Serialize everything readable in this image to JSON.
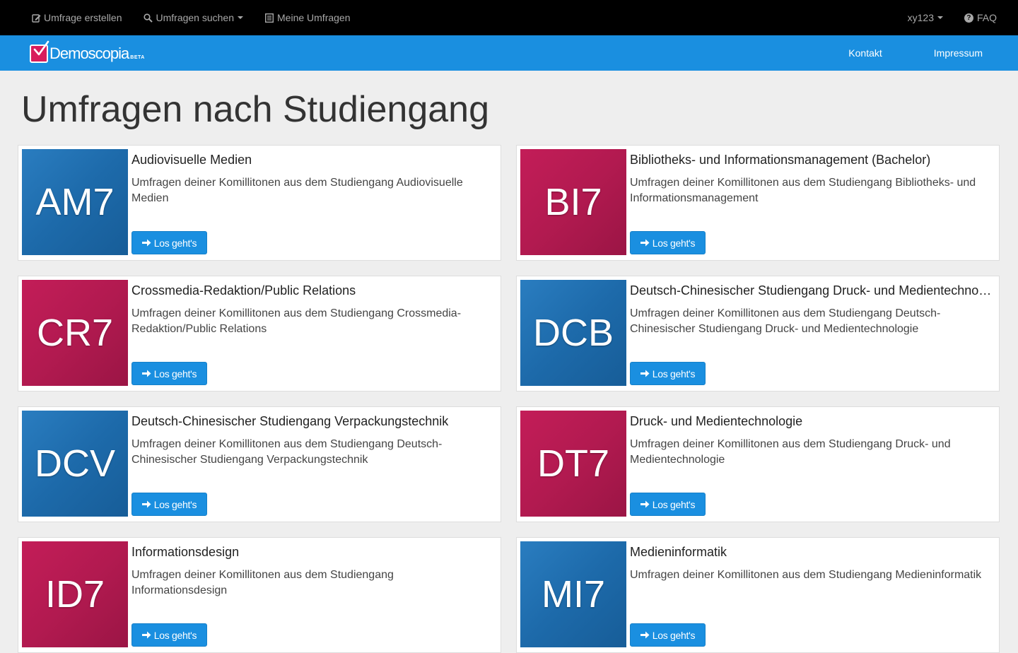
{
  "topnav": {
    "create": "Umfrage erstellen",
    "search": "Umfragen suchen",
    "mine": "Meine Umfragen",
    "user": "xy123",
    "faq": "FAQ"
  },
  "brand": {
    "name": "Demoscopia",
    "badge": "BETA",
    "links": [
      "Kontakt",
      "Impressum"
    ]
  },
  "page": {
    "title": "Umfragen nach Studiengang"
  },
  "button_label": "Los geht's",
  "courses": [
    {
      "code": "AM7",
      "color": "blue",
      "title": "Audiovisuelle Medien",
      "desc": "Umfragen deiner Komillitonen aus dem Studiengang Audiovisuelle Medien"
    },
    {
      "code": "BI7",
      "color": "pink",
      "title": "Bibliotheks- und Informationsmanagement (Bachelor)",
      "desc": "Umfragen deiner Komillitonen aus dem Studiengang Bibliotheks- und Informationsmanagement"
    },
    {
      "code": "CR7",
      "color": "pink",
      "title": "Crossmedia-Redaktion/Public Relations",
      "desc": "Umfragen deiner Komillitonen aus dem Studiengang Crossmedia-Redaktion/Public Relations"
    },
    {
      "code": "DCB",
      "color": "blue",
      "title": "Deutsch-Chinesischer Studiengang Druck- und Medientechnologie",
      "desc": "Umfragen deiner Komillitonen aus dem Studiengang Deutsch-Chinesischer Studiengang Druck- und Medientechnologie"
    },
    {
      "code": "DCV",
      "color": "blue",
      "title": "Deutsch-Chinesischer Studiengang Verpackungstechnik",
      "desc": "Umfragen deiner Komillitonen aus dem Studiengang Deutsch-Chinesischer Studiengang Verpackungstechnik"
    },
    {
      "code": "DT7",
      "color": "pink",
      "title": "Druck- und Medientechnologie",
      "desc": "Umfragen deiner Komillitonen aus dem Studiengang Druck- und Medientechnologie"
    },
    {
      "code": "ID7",
      "color": "pink",
      "title": "Informationsdesign",
      "desc": "Umfragen deiner Komillitonen aus dem Studiengang Informationsdesign"
    },
    {
      "code": "MI7",
      "color": "blue",
      "title": "Medieninformatik",
      "desc": "Umfragen deiner Komillitonen aus dem Studiengang Medieninformatik"
    }
  ],
  "colors": {
    "accent": "#1a8fe0",
    "tile_blue": "#1d6aaa",
    "tile_pink": "#b21a50",
    "topbar": "#000000"
  }
}
